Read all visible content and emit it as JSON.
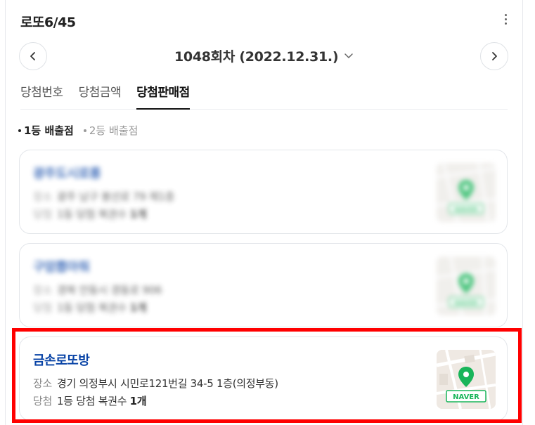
{
  "header": {
    "title": "로또6/45",
    "round_label": "1048회차 (2022.12.31.)"
  },
  "tabs": [
    {
      "label": "당첨번호",
      "active": false
    },
    {
      "label": "당첨금액",
      "active": false
    },
    {
      "label": "당첨판매점",
      "active": true
    }
  ],
  "subtabs": [
    {
      "label": "1등 배출점",
      "active": true
    },
    {
      "label": "2등 배출점",
      "active": false
    }
  ],
  "stores": [
    {
      "name": "광주도시로롱",
      "address_label": "장소",
      "address": "광주 남구 봉선로 79 제1층",
      "win_label": "당첨",
      "win_text": "1등 당첨 복권수",
      "win_count": "1개",
      "blurred": true
    },
    {
      "name": "구암뽑아줘",
      "address_label": "장소",
      "address": "경북 안동시 경동로 906",
      "win_label": "당첨",
      "win_text": "1등 당첨 복권수",
      "win_count": "1개",
      "blurred": true
    },
    {
      "name": "금손로또방",
      "address_label": "장소",
      "address": "경기 의정부시 시민로121번길 34-5 1층(의정부동)",
      "win_label": "당첨",
      "win_text": "1등 당첨 복권수",
      "win_count": "1개",
      "blurred": false
    }
  ],
  "map": {
    "badge": "NAVER",
    "pin_color": "#19b55a",
    "badge_color": "#19b55a"
  },
  "colors": {
    "store_name": "#0843a6",
    "highlight": "#ff0000"
  },
  "icons": {
    "prev": "chevron-left-icon",
    "next": "chevron-right-icon",
    "round_dropdown": "chevron-down-icon",
    "more": "more-vertical-icon",
    "map_pin": "map-pin-icon"
  }
}
